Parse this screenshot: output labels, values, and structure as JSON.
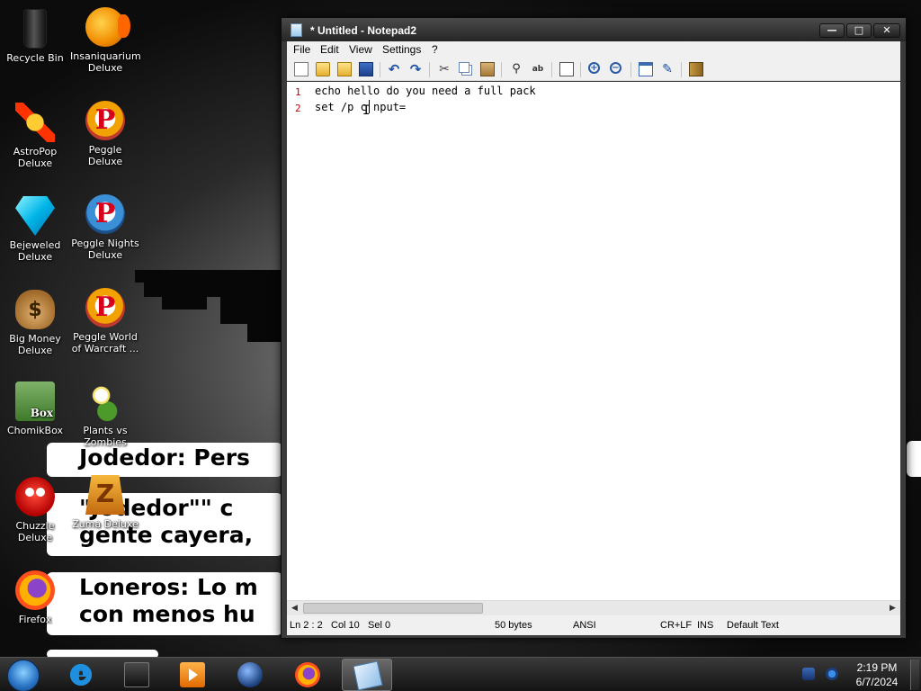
{
  "desktop": {
    "icons": [
      {
        "label": "Recycle Bin",
        "icon": "recycle-bin-icon"
      },
      {
        "label": "Insaniquarium Deluxe",
        "icon": "fish-icon"
      },
      {
        "label": "AstroPop Deluxe",
        "icon": "astropop-icon"
      },
      {
        "label": "Peggle Deluxe",
        "icon": "peggle-icon"
      },
      {
        "label": "Bejeweled Deluxe",
        "icon": "gem-icon"
      },
      {
        "label": "Peggle Nights Deluxe",
        "icon": "peggle-nights-icon"
      },
      {
        "label": "Big Money Deluxe",
        "icon": "money-bag-icon"
      },
      {
        "label": "Peggle World of Warcraft ...",
        "icon": "peggle-wow-icon"
      },
      {
        "label": "ChomikBox",
        "icon": "chomikbox-icon"
      },
      {
        "label": "Plants vs Zombies",
        "icon": "plants-icon"
      },
      {
        "label": "Chuzzle Deluxe",
        "icon": "chuzzle-icon"
      },
      {
        "label": "Zuma Deluxe",
        "icon": "zuma-icon"
      },
      {
        "label": "Firefox",
        "icon": "firefox-icon"
      }
    ],
    "wallpaper_captions": [
      {
        "lines": [
          "Jodedor: Pers"
        ]
      },
      {
        "lines": [
          "\"Jodedor\"\" c",
          "gente cayera,"
        ]
      },
      {
        "lines": [
          "Loneros: Lo m",
          "con menos hu"
        ]
      }
    ]
  },
  "window": {
    "title": "* Untitled - Notepad2",
    "controls": {
      "minimize": "—",
      "maximize": "□",
      "close": "✕"
    },
    "menu": [
      "File",
      "Edit",
      "View",
      "Settings",
      "?"
    ],
    "toolbar": [
      "new-icon",
      "open-icon",
      "browse-icon",
      "save-icon",
      "undo-icon",
      "redo-icon",
      "cut-icon",
      "copy-icon",
      "paste-icon",
      "find-icon",
      "replace-icon",
      "word-wrap-icon",
      "zoom-in-icon",
      "zoom-out-icon",
      "scheme-icon",
      "customize-icon",
      "exit-icon"
    ],
    "editor": {
      "lines": [
        {
          "number": "1",
          "text": "echo hello do you need a full pack"
        },
        {
          "number": "2",
          "text": "set /p c nput="
        }
      ]
    },
    "status": {
      "position": "Ln 2 : 2",
      "column": "Col 10",
      "selection": "Sel 0",
      "size": "50 bytes",
      "encoding": "ANSI",
      "line_endings": "CR+LF",
      "insert_mode": "INS",
      "scheme": "Default Text"
    }
  },
  "taskbar": {
    "apps": [
      "internet-explorer-icon",
      "explorer-icon",
      "media-player-icon",
      "globe-icon",
      "firefox-icon",
      "notepad2-icon"
    ],
    "clock": {
      "time": "2:19 PM",
      "date": "6/7/2024"
    }
  },
  "colors": {
    "line_number": "#c00000",
    "titlebar": "#2b2b2b",
    "taskbar": "#1e1e1e"
  }
}
